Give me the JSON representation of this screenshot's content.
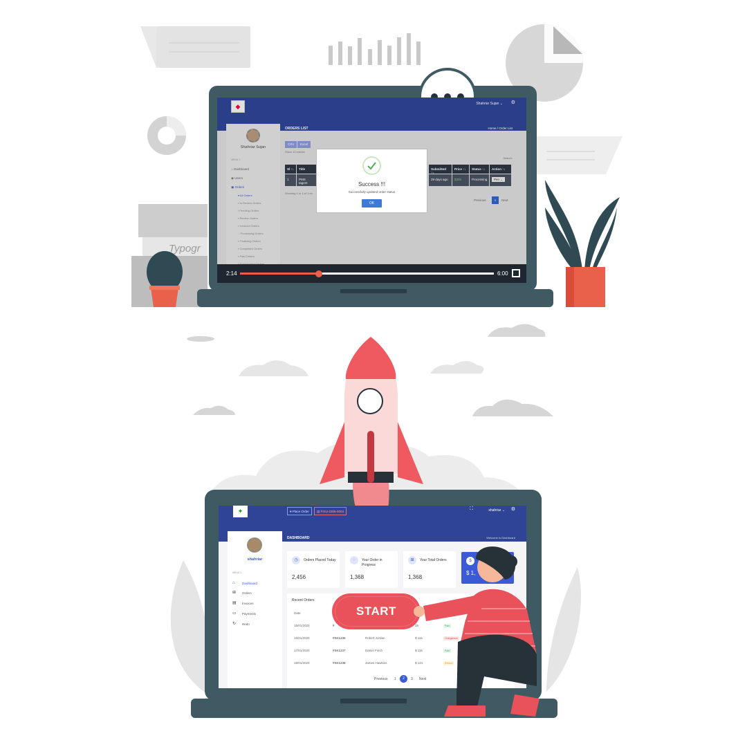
{
  "colors": {
    "header": "#2f4496",
    "accent": "#e9525a",
    "primary": "#3a5ad6",
    "success": "#4caf50"
  },
  "top_screen": {
    "user_name": "Shahriar Sujan",
    "user_menu": "Shahriar Sujan ⌄",
    "menu_label": "MENU 1",
    "nav": [
      "Dashboard",
      "Users",
      "Orders"
    ],
    "sub_nav": [
      "All Orders",
      "In Review Orders",
      "Pending Orders",
      "Review Orders",
      "Invoiced Orders",
      "Processing Orders",
      "Finalizing Orders",
      "Completed Orders",
      "Paid Orders",
      "Downloaded Orders"
    ],
    "page_title": "ORDERS LIST",
    "breadcrumb": "Home  /  Order List",
    "buttons": [
      "CSV",
      "Excel"
    ],
    "show_entries": "Show   10   entries",
    "search_label": "Search:",
    "table_headers": [
      "Sl ↑↓",
      "Title",
      "Submitted ↑↓",
      "Price ↑↓",
      "Status ↑↓",
      "Action ↑↓"
    ],
    "table_row": [
      "1",
      "PMS tagent",
      "29 days ago",
      "$300",
      "Processing",
      "Pen ⌄"
    ],
    "showing": "Showing 1 to 1 of 1 en",
    "pager": {
      "previous": "Previous",
      "page": "1",
      "next": "Next"
    },
    "modal": {
      "icon": "check-icon",
      "title": "Success !!!",
      "message": "Successfully updated order status",
      "ok": "OK"
    },
    "player": {
      "current": "2:14",
      "total": "6:00",
      "progress": 0.31
    }
  },
  "bottom_screen": {
    "place_order": "♥ Place Order",
    "pixu": "▤ PIXU-2306-0003",
    "user_menu": "shahriar ⌄",
    "user_name": "shahriar",
    "menu_label": "MENU 1",
    "nav": [
      "Dashboard",
      "Orders",
      "Invoices",
      "Payments",
      "Redo"
    ],
    "page_title": "DASHBOARD",
    "welcome": "Welcome to Dashboard",
    "cards": [
      {
        "label": "Orders Placed Today",
        "value": "2,456"
      },
      {
        "label": "Your Order in Progress",
        "value": "1,368"
      },
      {
        "label": "Your Total Orders",
        "value": "1,368"
      },
      {
        "label": "",
        "value": "$ 1,"
      }
    ],
    "recent": {
      "title": "Recent Orders",
      "date_header": "Date",
      "rows": [
        {
          "date": "15/01/2020",
          "id": "#",
          "name": "",
          "price": "25",
          "status": "Paid"
        },
        {
          "date": "16/01/2020",
          "id": "#SK1236",
          "name": "Robert Jordan",
          "price": "$ 116",
          "status": "Chargeback"
        },
        {
          "date": "17/01/2020",
          "id": "#SK1237",
          "name": "Daniel Finch",
          "price": "$ 116",
          "status": "Paid"
        },
        {
          "date": "18/01/2020",
          "id": "#SK1238",
          "name": "James Hawkins",
          "price": "$ 121",
          "status": "Refund"
        }
      ]
    },
    "pager": {
      "previous": "Previous",
      "pages": [
        "1",
        "2",
        "3"
      ],
      "next": "Next"
    }
  },
  "start_button": "START"
}
